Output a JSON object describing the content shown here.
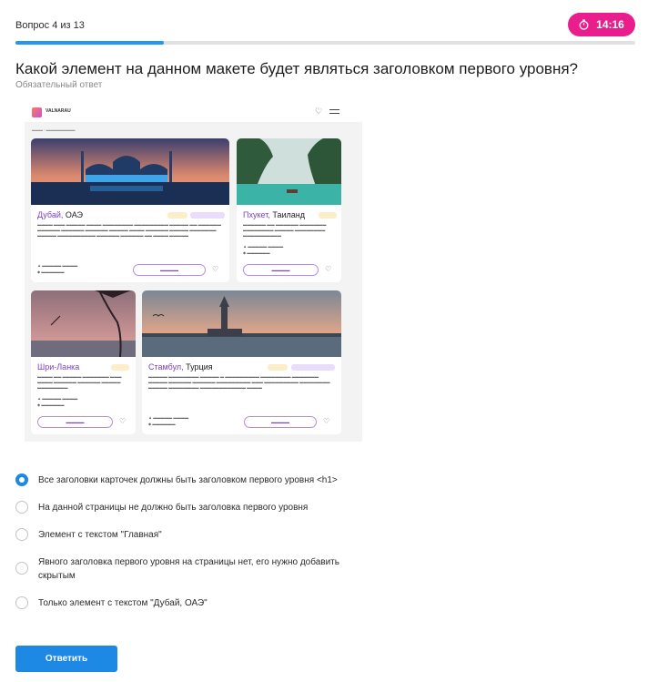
{
  "header": {
    "question_counter": "Вопрос 4 из 13",
    "timer": "14:16",
    "progress_fraction": 0.24
  },
  "question": {
    "title": "Какой элемент на данном макете будет являться заголовком первого уровня?",
    "required_note": "Обязательный ответ"
  },
  "mockup": {
    "logo_text": "VALNARAU",
    "cards": [
      {
        "city": "Дубай,",
        "country": "ОАЭ"
      },
      {
        "city": "Пхукет,",
        "country": "Таиланд"
      },
      {
        "city": "Шри-Ланка",
        "country": ""
      },
      {
        "city": "Стамбул,",
        "country": "Турция"
      }
    ]
  },
  "answers": [
    {
      "label": "Все заголовки карточек должны быть заголовком первого уровня <h1>",
      "checked": true
    },
    {
      "label": "На данной страницы не должно быть заголовка первого уровня",
      "checked": false
    },
    {
      "label": "Элемент с текстом \"Главная\"",
      "checked": false
    },
    {
      "label": "Явного заголовка первого уровня на страницы нет, его нужно добавить скрытым",
      "checked": false
    },
    {
      "label": "Только элемент с текстом \"Дубай, ОАЭ\"",
      "checked": false
    }
  ],
  "submit_label": "Ответить",
  "colors": {
    "accent": "#1e88e5",
    "timer_bg": "#e91e8c",
    "progress_track": "#e1e1e1"
  }
}
